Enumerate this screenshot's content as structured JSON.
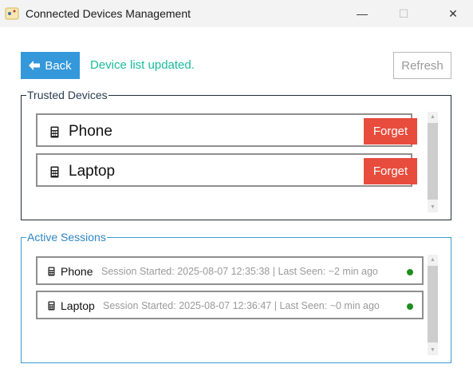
{
  "window": {
    "title": "Connected Devices Management",
    "controls": {
      "minimize": "—",
      "maximize": "☐",
      "close": "✕"
    }
  },
  "toolbar": {
    "back_label": "Back",
    "back_icon": "arrow-left-icon",
    "status_message": "Device list updated.",
    "refresh_label": "Refresh",
    "refresh_enabled": false
  },
  "trusted_devices": {
    "title": "Trusted Devices",
    "items": [
      {
        "name": "Phone",
        "icon": "device-icon",
        "action_label": "Forget"
      },
      {
        "name": "Laptop",
        "icon": "device-icon",
        "action_label": "Forget"
      }
    ]
  },
  "active_sessions": {
    "title": "Active Sessions",
    "items": [
      {
        "name": "Phone",
        "icon": "device-icon",
        "info": "Session Started: 2025-08-07 12:35:38 | Last Seen: ~2 min ago",
        "status": "online"
      },
      {
        "name": "Laptop",
        "icon": "device-icon",
        "info": "Session Started: 2025-08-07 12:36:47 | Last Seen: ~0 min ago",
        "status": "online"
      }
    ]
  },
  "colors": {
    "back_button": "#3498db",
    "status_text": "#1abc9c",
    "forget_button": "#e74c3c",
    "online_dot": "#1e8e1e",
    "sessions_border": "#3b9ad0"
  }
}
